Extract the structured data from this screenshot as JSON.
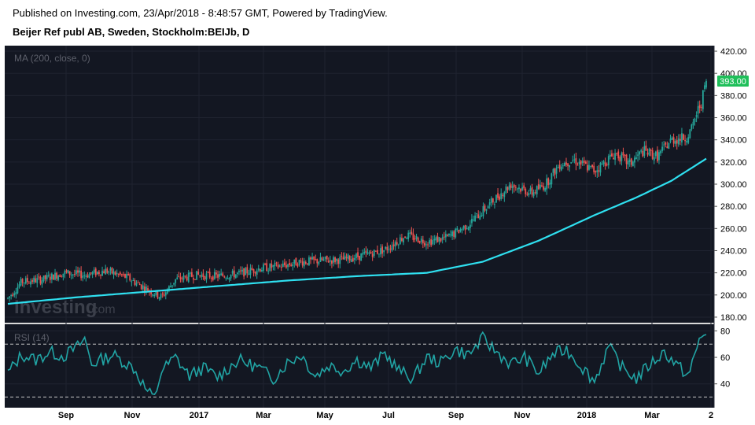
{
  "header": {
    "published": "Published on Investing.com, 23/Apr/2018 - 8:48:57 GMT, Powered by TradingView.",
    "title": "Beijer Ref publ AB, Sweden, Stockholm:BEIJb, D"
  },
  "watermark": {
    "brand": "Investing",
    "suffix": ".com"
  },
  "colors": {
    "background": "#131722",
    "up": "#26a69a",
    "down": "#ef5350",
    "ma": "#2fe0f0",
    "rsi": "#21a4a4",
    "last_price_badge": "#1fbf5a"
  },
  "chart_data": [
    {
      "type": "candlestick",
      "legend": "MA (200, close, 0)",
      "y_ticks": [
        "420.00",
        "400.00",
        "380.00",
        "360.00",
        "340.00",
        "320.00",
        "300.00",
        "280.00",
        "260.00",
        "240.00",
        "220.00",
        "200.00",
        "180.00"
      ],
      "ylim": [
        175,
        425
      ],
      "last_price": "393.00",
      "price_path": [
        [
          0,
          197
        ],
        [
          0.02,
          212
        ],
        [
          0.05,
          214
        ],
        [
          0.08,
          220
        ],
        [
          0.11,
          218
        ],
        [
          0.14,
          222
        ],
        [
          0.17,
          216
        ],
        [
          0.2,
          205
        ],
        [
          0.22,
          198
        ],
        [
          0.24,
          214
        ],
        [
          0.27,
          218
        ],
        [
          0.3,
          217
        ],
        [
          0.33,
          219
        ],
        [
          0.36,
          224
        ],
        [
          0.39,
          226
        ],
        [
          0.42,
          230
        ],
        [
          0.45,
          231
        ],
        [
          0.48,
          232
        ],
        [
          0.51,
          236
        ],
        [
          0.54,
          241
        ],
        [
          0.57,
          254
        ],
        [
          0.6,
          248
        ],
        [
          0.63,
          252
        ],
        [
          0.66,
          264
        ],
        [
          0.69,
          282
        ],
        [
          0.72,
          300
        ],
        [
          0.75,
          292
        ],
        [
          0.77,
          300
        ],
        [
          0.79,
          318
        ],
        [
          0.81,
          322
        ],
        [
          0.84,
          312
        ],
        [
          0.87,
          328
        ],
        [
          0.89,
          318
        ],
        [
          0.91,
          330
        ],
        [
          0.93,
          325
        ],
        [
          0.95,
          340
        ],
        [
          0.97,
          342
        ],
        [
          0.98,
          350
        ],
        [
          0.985,
          362
        ],
        [
          0.993,
          374
        ],
        [
          1.0,
          393
        ]
      ],
      "ma_path": [
        [
          0,
          192
        ],
        [
          0.1,
          198
        ],
        [
          0.2,
          203
        ],
        [
          0.3,
          208
        ],
        [
          0.4,
          213
        ],
        [
          0.5,
          217
        ],
        [
          0.6,
          220
        ],
        [
          0.68,
          230
        ],
        [
          0.76,
          249
        ],
        [
          0.84,
          272
        ],
        [
          0.9,
          288
        ],
        [
          0.95,
          303
        ],
        [
          1.0,
          323
        ]
      ]
    },
    {
      "type": "line",
      "legend": "RSI (14)",
      "y_ticks": [
        "80",
        "60",
        "40"
      ],
      "ylim": [
        22,
        85
      ],
      "guide_lines": [
        70,
        30
      ],
      "x_ticks": [
        "Sep",
        "Nov",
        "2017",
        "Mar",
        "May",
        "Jul",
        "Sep",
        "Nov",
        "2018",
        "Mar",
        "2"
      ],
      "rsi_path": [
        [
          0,
          48
        ],
        [
          0.02,
          62
        ],
        [
          0.04,
          58
        ],
        [
          0.06,
          64
        ],
        [
          0.08,
          61
        ],
        [
          0.1,
          68
        ],
        [
          0.11,
          74
        ],
        [
          0.12,
          55
        ],
        [
          0.15,
          62
        ],
        [
          0.18,
          52
        ],
        [
          0.2,
          34
        ],
        [
          0.21,
          29
        ],
        [
          0.22,
          50
        ],
        [
          0.24,
          60
        ],
        [
          0.26,
          46
        ],
        [
          0.28,
          52
        ],
        [
          0.3,
          45
        ],
        [
          0.33,
          58
        ],
        [
          0.36,
          52
        ],
        [
          0.38,
          44
        ],
        [
          0.4,
          56
        ],
        [
          0.42,
          62
        ],
        [
          0.44,
          46
        ],
        [
          0.46,
          54
        ],
        [
          0.48,
          50
        ],
        [
          0.5,
          58
        ],
        [
          0.52,
          52
        ],
        [
          0.54,
          63
        ],
        [
          0.56,
          50
        ],
        [
          0.58,
          44
        ],
        [
          0.6,
          60
        ],
        [
          0.62,
          56
        ],
        [
          0.64,
          66
        ],
        [
          0.66,
          62
        ],
        [
          0.68,
          74
        ],
        [
          0.7,
          64
        ],
        [
          0.72,
          55
        ],
        [
          0.74,
          60
        ],
        [
          0.76,
          48
        ],
        [
          0.78,
          62
        ],
        [
          0.8,
          66
        ],
        [
          0.82,
          54
        ],
        [
          0.84,
          42
        ],
        [
          0.86,
          68
        ],
        [
          0.88,
          52
        ],
        [
          0.9,
          44
        ],
        [
          0.92,
          55
        ],
        [
          0.94,
          64
        ],
        [
          0.96,
          53
        ],
        [
          0.975,
          46
        ],
        [
          0.99,
          73
        ],
        [
          1.0,
          80
        ]
      ]
    }
  ]
}
